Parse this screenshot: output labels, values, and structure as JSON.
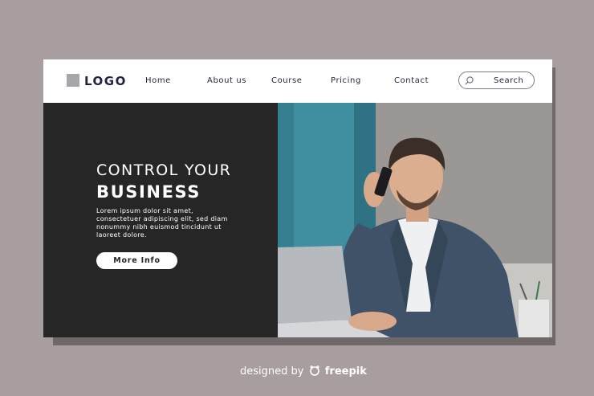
{
  "logo": {
    "text": "LOGO"
  },
  "nav": {
    "links": [
      {
        "label": "Home"
      },
      {
        "label": "About us"
      },
      {
        "label": "Course"
      },
      {
        "label": "Pricing"
      },
      {
        "label": "Contact"
      }
    ],
    "search": {
      "label": "Search",
      "icon": "search-icon"
    }
  },
  "hero": {
    "title_line1": "CONTROL YOUR",
    "title_line2": "BUSINESS",
    "body": "Lorem ipsum dolor sit amet, consectetuer adipiscing elit, sed diam nonummy nibh euismod tincidunt ut laoreet dolore.",
    "cta_label": "More Info"
  },
  "photo": {
    "subject": "man-on-phone-with-laptop"
  },
  "footer": {
    "prefix": "designed by",
    "brand": "freepik"
  },
  "colors": {
    "background": "#a89e9f",
    "dark_panel": "#262627",
    "navy_text": "#1f2340",
    "white": "#ffffff"
  }
}
